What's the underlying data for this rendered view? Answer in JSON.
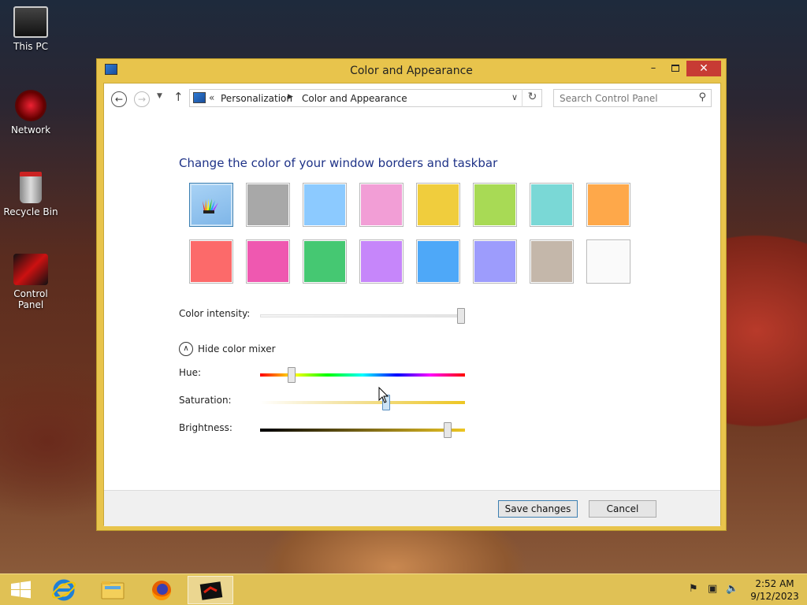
{
  "desktop": {
    "icons": [
      {
        "label": "This PC",
        "icon": "computer-icon"
      },
      {
        "label": "Network",
        "icon": "network-icon"
      },
      {
        "label": "Recycle Bin",
        "icon": "recycle-bin-icon"
      },
      {
        "label": "Control Panel",
        "icon": "control-panel-icon"
      }
    ]
  },
  "window": {
    "title": "Color and Appearance",
    "controls": {
      "minimize": "–",
      "close": "✕"
    },
    "address": {
      "overflow": "«",
      "crumbs": [
        "Personalization",
        "Color and Appearance"
      ]
    },
    "search": {
      "placeholder": "Search Control Panel"
    },
    "heading": "Change the color of your window borders and taskbar",
    "swatches": [
      {
        "name": "automatic",
        "color": "#8ec5f2",
        "selected": true
      },
      {
        "name": "gray",
        "color": "#a8a8a8"
      },
      {
        "name": "sky-blue",
        "color": "#8ccaff"
      },
      {
        "name": "pink",
        "color": "#f29ed6"
      },
      {
        "name": "gold",
        "color": "#f0cd3d"
      },
      {
        "name": "lime",
        "color": "#a8da55"
      },
      {
        "name": "teal",
        "color": "#7ad8d6"
      },
      {
        "name": "orange",
        "color": "#fea84a"
      },
      {
        "name": "coral",
        "color": "#fc6a6a"
      },
      {
        "name": "magenta",
        "color": "#ef58b0"
      },
      {
        "name": "green",
        "color": "#45c872"
      },
      {
        "name": "violet",
        "color": "#c686fa"
      },
      {
        "name": "blue",
        "color": "#4ea8f8"
      },
      {
        "name": "periwinkle",
        "color": "#9d9cfc"
      },
      {
        "name": "taupe",
        "color": "#c4b7aa"
      },
      {
        "name": "white",
        "color": "#fafafa"
      }
    ],
    "intensity": {
      "label": "Color intensity:",
      "level": 1.0
    },
    "mixer": {
      "toggle_label": "Hide color mixer",
      "hue": {
        "label": "Hue:",
        "level": 0.14
      },
      "saturation": {
        "label": "Saturation:",
        "level": 0.62
      },
      "brightness": {
        "label": "Brightness:",
        "level": 0.93
      }
    },
    "buttons": {
      "save": "Save changes",
      "cancel": "Cancel"
    }
  },
  "colors": {
    "accent": "#e8c44c",
    "heading": "#1e3287",
    "close": "#c73b34"
  },
  "taskbar": {
    "apps": [
      "internet-explorer-icon",
      "file-explorer-icon",
      "firefox-icon",
      "control-panel-icon"
    ],
    "clock": {
      "time": "2:52 AM",
      "date": "9/12/2023"
    }
  }
}
